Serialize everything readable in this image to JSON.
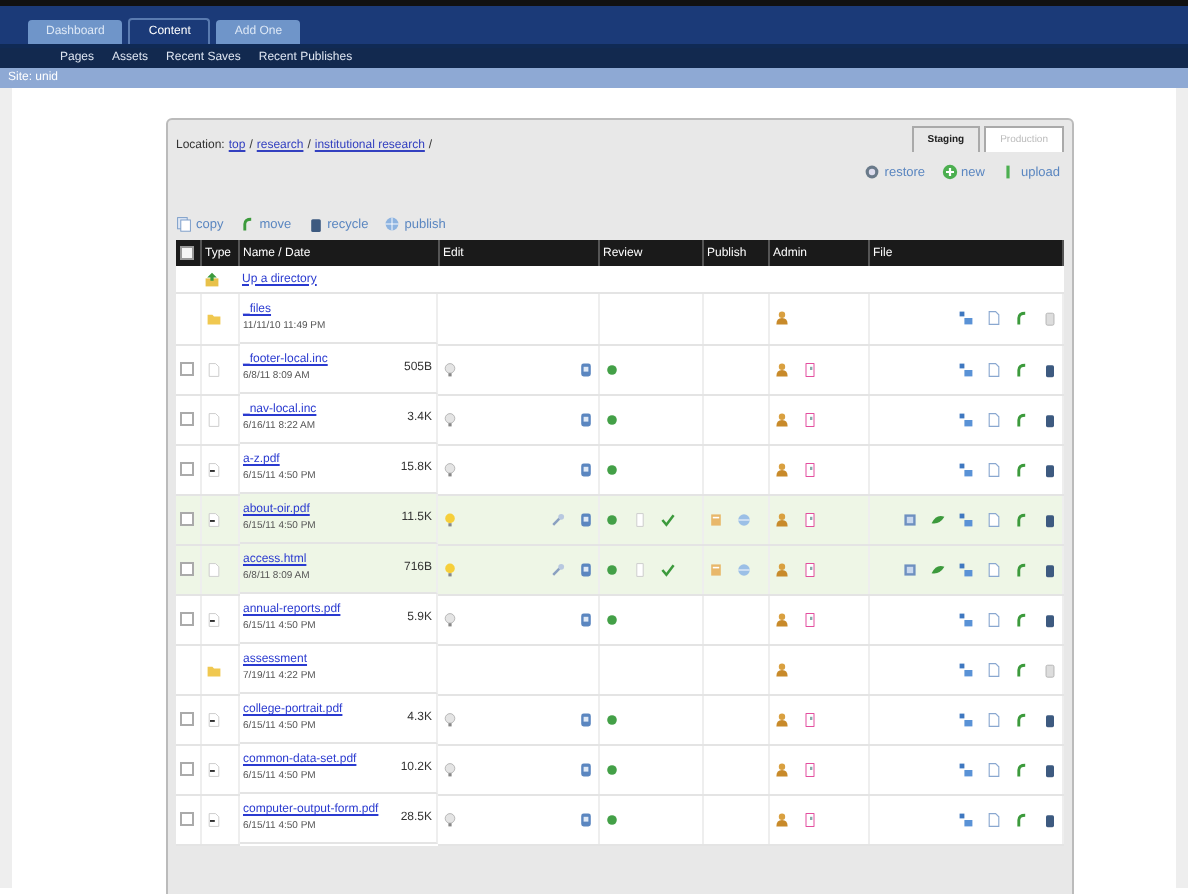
{
  "top_tabs": [
    {
      "label": "Dashboard",
      "selected": false
    },
    {
      "label": "Content",
      "selected": true
    },
    {
      "label": "Add One",
      "selected": false
    }
  ],
  "sub_nav": [
    "Pages",
    "Assets",
    "Recent Saves",
    "Recent Publishes"
  ],
  "site_bar": "Site: unid",
  "location": {
    "label": "Location:",
    "separator": "/",
    "crumbs": [
      "top",
      "research",
      "institutional research"
    ]
  },
  "env_tabs": [
    {
      "label": "Staging",
      "selected": true
    },
    {
      "label": "Production",
      "selected": false
    }
  ],
  "actions_right": [
    "restore",
    "new",
    "upload"
  ],
  "actions_left": [
    "copy",
    "move",
    "recycle",
    "publish"
  ],
  "table": {
    "select_all_checked": false,
    "columns": [
      "Type",
      "Name / Date",
      "Edit",
      "Review",
      "Publish",
      "Admin",
      "File"
    ],
    "up_link": "Up a directory",
    "rows": [
      {
        "kind": "folder",
        "name": "_files",
        "date": "11/11/10 11:49 PM",
        "modified": false
      },
      {
        "kind": "doc",
        "name": "_footer-local.inc",
        "date": "6/8/11 8:09 AM",
        "size": "505B",
        "modified": false,
        "checked": false
      },
      {
        "kind": "doc",
        "name": "_nav-local.inc",
        "date": "6/16/11 8:22 AM",
        "size": "3.4K",
        "modified": false,
        "checked": false
      },
      {
        "kind": "pdf",
        "name": "a-z.pdf",
        "date": "6/15/11 4:50 PM",
        "size": "15.8K",
        "modified": false,
        "checked": false
      },
      {
        "kind": "pdf",
        "name": "about-oir.pdf",
        "date": "6/15/11 4:50 PM",
        "size": "11.5K",
        "modified": true,
        "checked": false
      },
      {
        "kind": "doc",
        "name": "access.html",
        "date": "6/8/11 8:09 AM",
        "size": "716B",
        "modified": true,
        "checked": false
      },
      {
        "kind": "pdf",
        "name": "annual-reports.pdf",
        "date": "6/15/11 4:50 PM",
        "size": "5.9K",
        "modified": false,
        "checked": false
      },
      {
        "kind": "folder",
        "name": "assessment",
        "date": "7/19/11 4:22 PM",
        "modified": false
      },
      {
        "kind": "pdf",
        "name": "college-portrait.pdf",
        "date": "6/15/11 4:50 PM",
        "size": "4.3K",
        "modified": false,
        "checked": false
      },
      {
        "kind": "pdf",
        "name": "common-data-set.pdf",
        "date": "6/15/11 4:50 PM",
        "size": "10.2K",
        "modified": false,
        "checked": false
      },
      {
        "kind": "pdf",
        "name": "computer-output-form.pdf",
        "date": "6/15/11 4:50 PM",
        "size": "28.5K",
        "modified": false,
        "checked": false
      }
    ]
  }
}
